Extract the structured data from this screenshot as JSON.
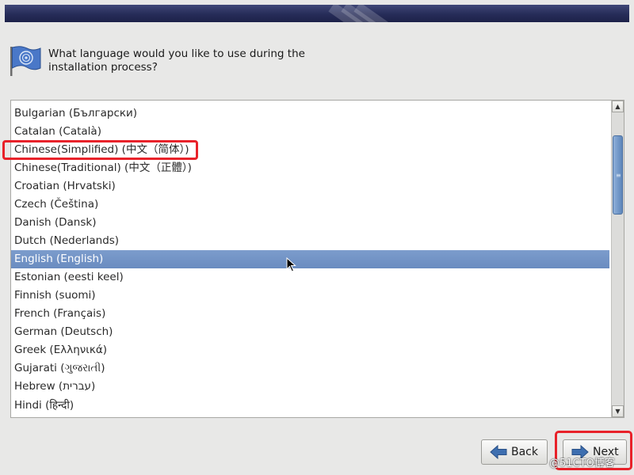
{
  "header": {
    "question": "What language would you like to use during the installation process?"
  },
  "language_list": {
    "items": [
      "Bulgarian (Български)",
      "Catalan (Català)",
      "Chinese(Simplified) (中文（简体）)",
      "Chinese(Traditional) (中文（正體）)",
      "Croatian (Hrvatski)",
      "Czech (Čeština)",
      "Danish (Dansk)",
      "Dutch (Nederlands)",
      "English (English)",
      "Estonian (eesti keel)",
      "Finnish (suomi)",
      "French (Français)",
      "German (Deutsch)",
      "Greek (Ελληνικά)",
      "Gujarati (ગુજરાતી)",
      "Hebrew (עברית)",
      "Hindi (हिन्दी)"
    ],
    "selected": "English (English)"
  },
  "buttons": {
    "back": "Back",
    "next": "Next"
  },
  "watermark": "@51CTO博客",
  "colors": {
    "selection": "#6a8cc0",
    "annotation": "#e8222a",
    "banner": "#262c58"
  }
}
